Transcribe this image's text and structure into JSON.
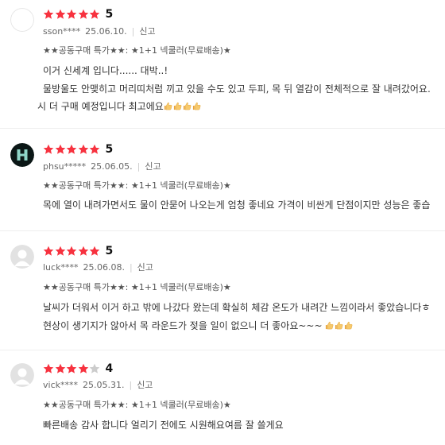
{
  "reviews": [
    {
      "score": "5",
      "user": "sson****",
      "date": "25.06.10.",
      "report": "신고",
      "option": "★★공동구매 특가★★: ★1+1 넥쿨러(무료배송)★",
      "lines": [
        "이거 신세계 입니다...... 대박..!",
        "물방울도 안맺히고 머리띠처럼 끼고 있을 수도 있고 두피, 목 뒤 열감이 전체적으로 잘 내려갔어요.",
        "시 더 구매 예정입니다 최고에요"
      ],
      "rating": 5,
      "avatar": "blank",
      "emoji_count": 4
    },
    {
      "score": "5",
      "user": "phsu*****",
      "date": "25.06.05.",
      "report": "신고",
      "option": "★★공동구매 특가★★: ★1+1 넥쿨러(무료배송)★",
      "lines": [
        "목에 열이 내려가면서도 물이 안묻어 나오는게 엄청 좋네요 가격이 비싼게 단점이지만 성능은 좋습"
      ],
      "rating": 5,
      "avatar": "H-logo",
      "emoji_count": 0
    },
    {
      "score": "5",
      "user": "luck****",
      "date": "25.06.08.",
      "report": "신고",
      "option": "★★공동구매 특가★★: ★1+1 넥쿨러(무료배송)★",
      "lines": [
        "날씨가 더워서 이거 하고 밖에 나갔다 왔는데 확실히 체감 온도가 내려간 느낌이라서 좋았습니다ㅎ",
        "현상이 생기지가 않아서 목 라운드가 젖을 일이 없으니 더 좋아요~~~"
      ],
      "rating": 5,
      "avatar": "default-person",
      "emoji_count": 3
    },
    {
      "score": "4",
      "user": "vick****",
      "date": "25.05.31.",
      "report": "신고",
      "option": "★★공동구매 특가★★: ★1+1 넥쿨러(무료배송)★",
      "lines": [
        "빠른배송 감사 합니다 얼리기 전에도 시원해요여름 잘 쓸게요"
      ],
      "rating": 4,
      "avatar": "default-person",
      "emoji_count": 0
    }
  ],
  "colors": {
    "star_on": "#f7323f",
    "star_off": "#cccccc",
    "divider": "#eeeeee"
  },
  "icons": {
    "star": "star-icon",
    "thumbs": "thumbs-up-icon"
  }
}
